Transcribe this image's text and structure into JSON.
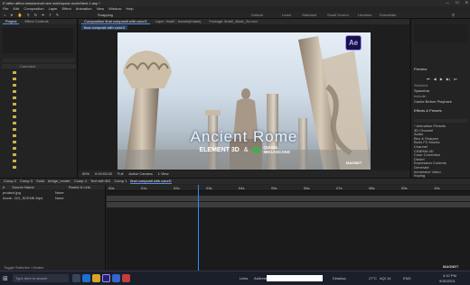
{
  "window": {
    "title": "E:\\after affect sessions\\all new work\\spout-model\\test 1.aep *"
  },
  "menu": [
    "File",
    "Edit",
    "Composition",
    "Layer",
    "Effect",
    "Animation",
    "View",
    "Window",
    "Help"
  ],
  "toolbar": {
    "snapping": "Snapping",
    "workspaces": [
      "Default",
      "Learn",
      "Standard",
      "Small Screen",
      "Libraries",
      "Essentials"
    ]
  },
  "viewer": {
    "tabs": [
      "Composition final compositi with colorD",
      "Layer: final0 - frames(intake)",
      "Footage: final0_4klab_2k.mov"
    ],
    "subtab": "final composit with colorD",
    "scene": {
      "title": "Ancient Rome",
      "element": "ELEMENT 3D",
      "amp": "&",
      "quixel": "QUIXEL MEGASCANS",
      "badge": "Ae",
      "brand": "MAGNET"
    },
    "footer": [
      "50%",
      "0:00:03:00",
      "Full",
      "Active Camera",
      "1 View"
    ]
  },
  "left_panel": {
    "tabs": [
      "Project",
      "Effect Controls"
    ],
    "column": "Comment"
  },
  "right_panel": {
    "preview_title": "Preview",
    "shortcut_label": "Shortcut",
    "shortcut_value": "Spacebar",
    "include_label": "Include:",
    "cache_label": "Cache Before Playback",
    "effects_title": "Effects & Presets",
    "effects": [
      "* Animation Presets",
      "3D Channel",
      "Audio",
      "Blur & Sharpen",
      "Boris FX Mocha",
      "Channel",
      "CINEMA 4D",
      "Color Correction",
      "Distort",
      "Expression Controls",
      "Generate",
      "Immersive Video",
      "Keying",
      "Matte",
      "Noise & Grain",
      "Obsolete",
      "Perspective"
    ]
  },
  "timeline": {
    "tabs": [
      "Comp 2",
      "Comp 3",
      "Solid",
      "bridge_render",
      "Comp 4",
      "Text with BG",
      "Comp 1",
      "final composit with colorD"
    ],
    "layers_header": [
      "#",
      "Source Name",
      "Parent & Link"
    ],
    "layers": [
      {
        "name": "product.jpg",
        "parent": "None"
      },
      {
        "name": "Ancie...DO_SCENE.Mp4",
        "parent": "None"
      }
    ],
    "ruler": [
      "00s",
      "01s",
      "02s",
      "03s",
      "04s",
      "05s",
      "06s",
      "07s",
      "08s",
      "09s",
      "10s"
    ],
    "footer": "Toggle Switches / Modes"
  },
  "taskbar": {
    "search": "Type here to search",
    "links": "Links",
    "address": "Address",
    "desktop": "Desktop",
    "weather": "27°C",
    "aqi": "AQI 14",
    "lang": "ENG",
    "time": "4:10 PM",
    "date": "9/30/2021",
    "watermark": "MAGNET"
  },
  "colors": {
    "accent": "#2f8bff",
    "panel": "#232323",
    "ae_purple": "#9a8cff",
    "green": "#3fb14a"
  }
}
